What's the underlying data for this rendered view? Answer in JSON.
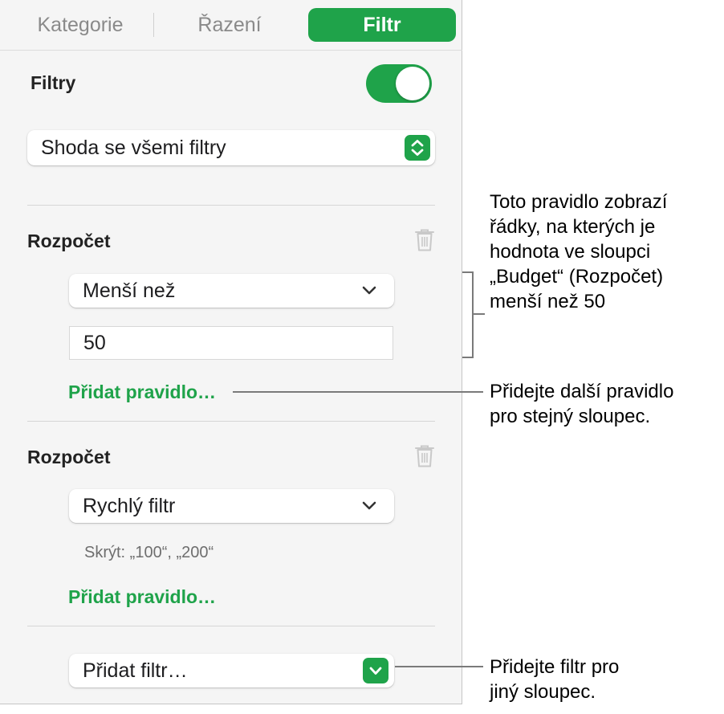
{
  "tabs": [
    {
      "label": "Kategorie"
    },
    {
      "label": "Řazení"
    },
    {
      "label": "Filtr"
    }
  ],
  "filters": {
    "title": "Filtry",
    "enabled": true,
    "match_select": "Shoda se všemi filtry"
  },
  "rules": [
    {
      "column": "Rozpočet",
      "condition": "Menší než",
      "value": "50",
      "add_rule": "Přidat pravidlo…"
    },
    {
      "column": "Rozpočet",
      "condition": "Rychlý filtr",
      "hint": "Skrýt: „100“, „200“",
      "add_rule": "Přidat pravidlo…"
    }
  ],
  "add_filter": "Přidat filtr…",
  "callouts": {
    "rule": [
      "Toto pravidlo zobrazí",
      "řádky, na kterých je",
      "hodnota ve sloupci",
      "„Budget“ (Rozpočet)",
      "menší než 50"
    ],
    "add_rule": [
      "Přidejte další pravidlo",
      "pro stejný sloupec."
    ],
    "add_filter": [
      "Přidejte filtr pro",
      "jiný sloupec."
    ]
  },
  "colors": {
    "accent": "#1fa34a",
    "panel": "#f5f5f5"
  }
}
